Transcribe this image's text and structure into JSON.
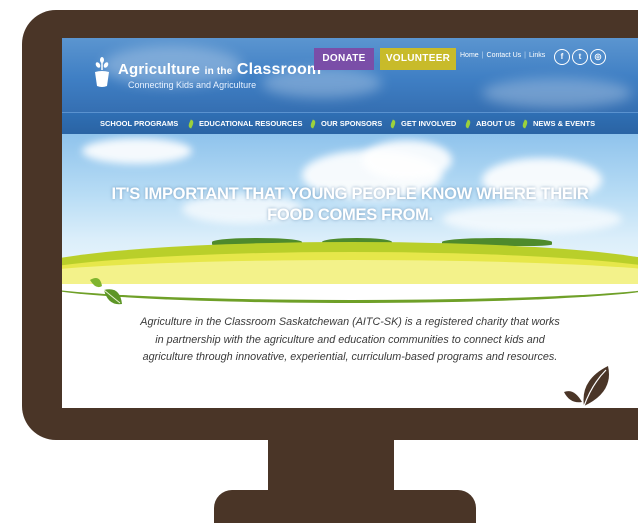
{
  "header": {
    "logo": {
      "title_part1": "Agriculture",
      "title_part2": "in the",
      "title_part3": "Classroom",
      "tagline": "Connecting Kids and Agriculture"
    },
    "donate_label": "DONATE",
    "volunteer_label": "VOLUNTEER",
    "links": [
      "Home",
      "Contact Us",
      "Links"
    ],
    "social": [
      {
        "icon": "facebook-icon",
        "glyph": "f"
      },
      {
        "icon": "twitter-icon",
        "glyph": "t"
      },
      {
        "icon": "instagram-icon",
        "glyph": "◎"
      }
    ]
  },
  "nav": {
    "items": [
      {
        "label": "SCHOOL PROGRAMS"
      },
      {
        "label": "EDUCATIONAL RESOURCES"
      },
      {
        "label": "OUR SPONSORS"
      },
      {
        "label": "GET INVOLVED"
      },
      {
        "label": "ABOUT US"
      },
      {
        "label": "NEWS & EVENTS"
      }
    ]
  },
  "hero": {
    "line1": "IT'S IMPORTANT THAT YOUNG PEOPLE KNOW WHERE THEIR",
    "line2": "FOOD COMES FROM."
  },
  "intro": {
    "text": "Agriculture in the Classroom Saskatchewan (AITC-SK) is a registered charity that works in partnership with the agriculture and education communities to connect kids and agriculture through innovative, experiential, curriculum-based programs and resources."
  },
  "colors": {
    "monitor": "#4a3527",
    "header_blue": "#3f7fc4",
    "nav_blue": "#2f6fb4",
    "donate": "#7a4ea8",
    "volunteer": "#c8bb2a",
    "leaf_green": "#7fb52e"
  }
}
